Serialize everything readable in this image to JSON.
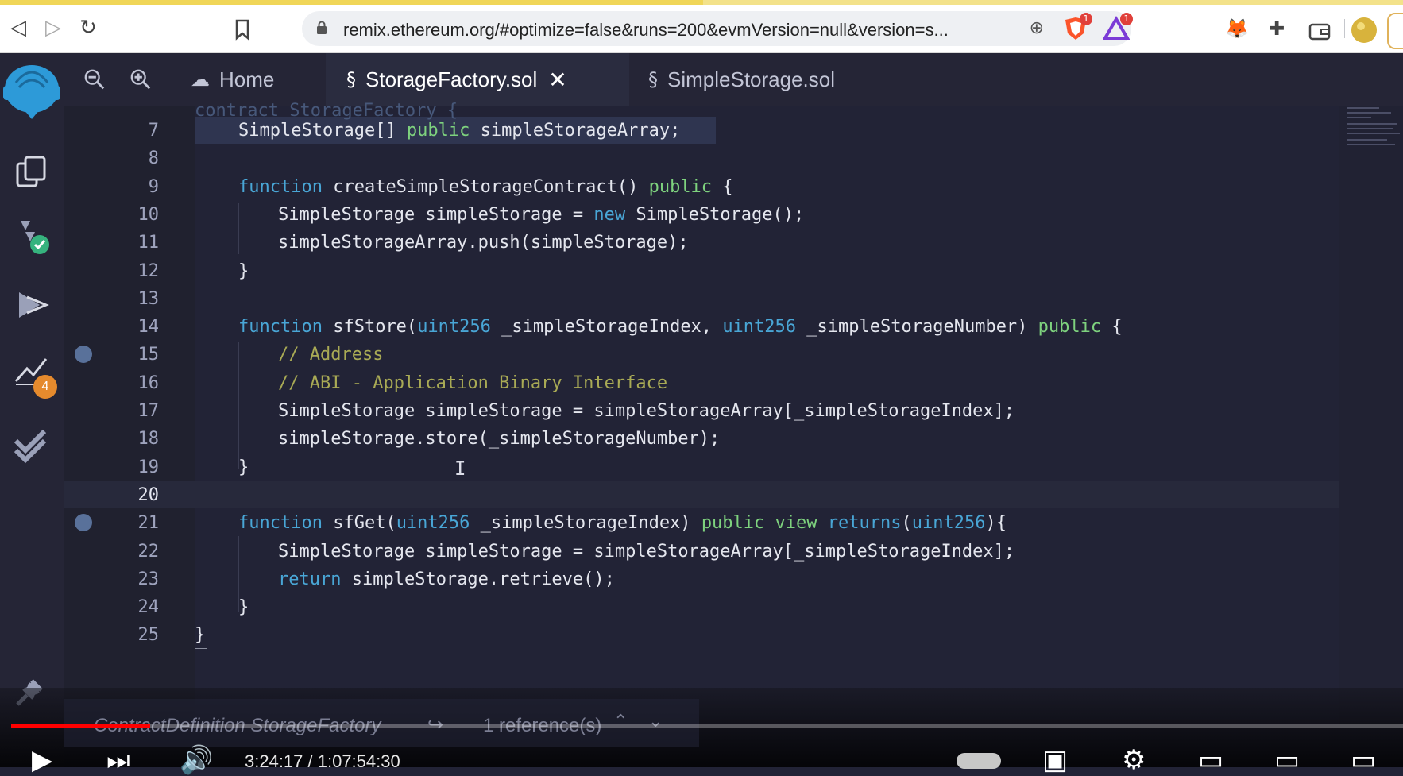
{
  "browser": {
    "url": "remix.ethereum.org/#optimize=false&runs=200&evmVersion=null&version=s...",
    "brave_badge_count": "1",
    "alert_badge_count": "1"
  },
  "tabs": [
    {
      "label": "Home",
      "icon": "home-icon",
      "active": false
    },
    {
      "label": "StorageFactory.sol",
      "icon": "solidity-file-icon",
      "active": true,
      "close": "✕"
    },
    {
      "label": "SimpleStorage.sol",
      "icon": "solidity-file-icon",
      "active": false
    }
  ],
  "sidebar": {
    "analysis_badge_count": "4"
  },
  "editor": {
    "partial_top_line": "contract StorageFactory {",
    "lines": [
      {
        "n": "7",
        "code": "SimpleStorage[] public simpleStorageArray;"
      },
      {
        "n": "8",
        "code": ""
      },
      {
        "n": "9",
        "code": "function createSimpleStorageContract() public {"
      },
      {
        "n": "10",
        "code": "SimpleStorage simpleStorage = new SimpleStorage();"
      },
      {
        "n": "11",
        "code": "simpleStorageArray.push(simpleStorage);"
      },
      {
        "n": "12",
        "code": "}"
      },
      {
        "n": "13",
        "code": ""
      },
      {
        "n": "14",
        "code": "function sfStore(uint256 _simpleStorageIndex, uint256 _simpleStorageNumber) public {"
      },
      {
        "n": "15",
        "code": "// Address"
      },
      {
        "n": "16",
        "code": "// ABI - Application Binary Interface"
      },
      {
        "n": "17",
        "code": "SimpleStorage simpleStorage = simpleStorageArray[_simpleStorageIndex];"
      },
      {
        "n": "18",
        "code": "simpleStorage.store(_simpleStorageNumber);"
      },
      {
        "n": "19",
        "code": "}"
      },
      {
        "n": "20",
        "code": ""
      },
      {
        "n": "21",
        "code": "function sfGet(uint256 _simpleStorageIndex) public view returns(uint256){"
      },
      {
        "n": "22",
        "code": "SimpleStorage simpleStorage = simpleStorageArray[_simpleStorageIndex];"
      },
      {
        "n": "23",
        "code": "return simpleStorage.retrieve();"
      },
      {
        "n": "24",
        "code": "}"
      },
      {
        "n": "25",
        "code": "}"
      }
    ],
    "current_line": "20",
    "breakpoint_lines": [
      "15",
      "21"
    ]
  },
  "status_bar": {
    "definition": "ContractDefinition StorageFactory",
    "references": "1 reference(s)"
  },
  "video_player": {
    "time": "3:24:17 / 1:07:54:30",
    "progress_fraction": 0.1
  },
  "colors": {
    "keyword": "#49a6d6",
    "modifier": "#7ed27e",
    "comment": "#a9aa55",
    "text": "#e4e6ee",
    "background": "#222336"
  }
}
